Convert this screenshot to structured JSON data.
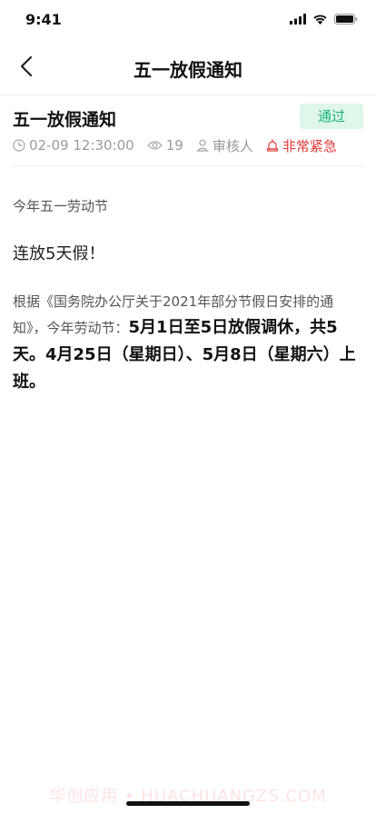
{
  "status_bar": {
    "time": "9:41",
    "icons": [
      "signal-icon",
      "wifi-icon",
      "battery-icon"
    ]
  },
  "nav": {
    "back_icon": "chevron-left-icon",
    "title": "五一放假通知"
  },
  "notice": {
    "title": "五一放假通知",
    "status": "通过",
    "status_color": "#19b47b",
    "meta": {
      "datetime": "02-09 12:30:00",
      "views": "19",
      "reviewer": "审核人",
      "urgency": "非常紧急",
      "urgency_color": "#e23b3b"
    }
  },
  "content": {
    "line1": "今年五一劳动节",
    "line2": "连放5天假！",
    "body_normal": "根据《国务院办公厅关于2021年部分节假日安排的通知》，今年劳动节：",
    "body_bold": "5月1日至5日放假调休，共5天。4月25日（星期日）、5月8日（星期六）上班。"
  },
  "watermark": "华创应用 • HUACHUANGZS.COM"
}
